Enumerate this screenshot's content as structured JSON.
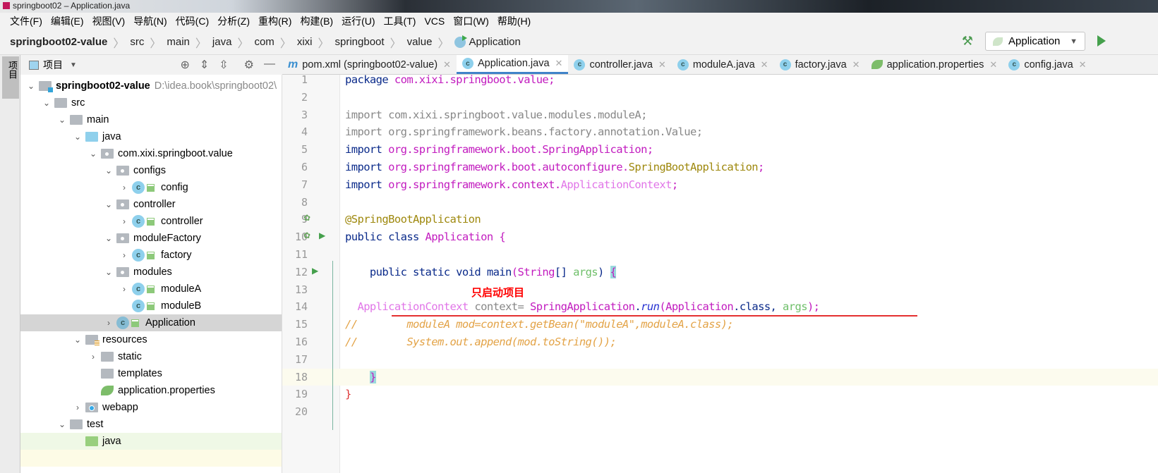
{
  "window": {
    "title": "springboot02 – Application.java"
  },
  "menu": [
    "文件(F)",
    "编辑(E)",
    "视图(V)",
    "导航(N)",
    "代码(C)",
    "分析(Z)",
    "重构(R)",
    "构建(B)",
    "运行(U)",
    "工具(T)",
    "VCS",
    "窗口(W)",
    "帮助(H)"
  ],
  "breadcrumb": [
    "springboot02-value",
    "src",
    "main",
    "java",
    "com",
    "xixi",
    "springboot",
    "value",
    "Application"
  ],
  "run_config": {
    "label": "Application"
  },
  "sidebar_tab": "项目",
  "project_panel": {
    "title": "项目"
  },
  "tree": [
    {
      "label": "springboot02-value",
      "path": "D:\\idea.book\\springboot02\\",
      "level": 0,
      "chev": "v",
      "icon": "module-folder",
      "bold": true
    },
    {
      "label": "src",
      "level": 1,
      "chev": "v",
      "icon": "folder"
    },
    {
      "label": "main",
      "level": 2,
      "chev": "v",
      "icon": "folder"
    },
    {
      "label": "java",
      "level": 3,
      "chev": "v",
      "icon": "source-folder"
    },
    {
      "label": "com.xixi.springboot.value",
      "level": 4,
      "chev": "v",
      "icon": "package"
    },
    {
      "label": "configs",
      "level": 5,
      "chev": "v",
      "icon": "package"
    },
    {
      "label": "config",
      "level": 6,
      "chev": ">",
      "icon": "class"
    },
    {
      "label": "controller",
      "level": 5,
      "chev": "v",
      "icon": "package"
    },
    {
      "label": "controller",
      "level": 6,
      "chev": ">",
      "icon": "class"
    },
    {
      "label": "moduleFactory",
      "level": 5,
      "chev": "v",
      "icon": "package"
    },
    {
      "label": "factory",
      "level": 6,
      "chev": ">",
      "icon": "class"
    },
    {
      "label": "modules",
      "level": 5,
      "chev": "v",
      "icon": "package"
    },
    {
      "label": "moduleA",
      "level": 6,
      "chev": ">",
      "icon": "class"
    },
    {
      "label": "moduleB",
      "level": 6,
      "chev": "",
      "icon": "class"
    },
    {
      "label": "Application",
      "level": 5,
      "chev": ">",
      "icon": "spring-class",
      "selected": true
    },
    {
      "label": "resources",
      "level": 3,
      "chev": "v",
      "icon": "resources-folder"
    },
    {
      "label": "static",
      "level": 4,
      "chev": ">",
      "icon": "folder"
    },
    {
      "label": "templates",
      "level": 4,
      "chev": "",
      "icon": "folder"
    },
    {
      "label": "application.properties",
      "level": 4,
      "chev": "",
      "icon": "spring"
    },
    {
      "label": "webapp",
      "level": 3,
      "chev": ">",
      "icon": "web-folder"
    },
    {
      "label": "test",
      "level": 2,
      "chev": "v",
      "icon": "folder"
    },
    {
      "label": "java",
      "level": 3,
      "chev": "",
      "icon": "test-folder",
      "green": true
    }
  ],
  "tabs": [
    {
      "label": "pom.xml (springboot02-value)",
      "icon": "maven"
    },
    {
      "label": "Application.java",
      "icon": "spring-class",
      "active": true
    },
    {
      "label": "controller.java",
      "icon": "class"
    },
    {
      "label": "moduleA.java",
      "icon": "class"
    },
    {
      "label": "factory.java",
      "icon": "class"
    },
    {
      "label": "application.properties",
      "icon": "spring"
    },
    {
      "label": "config.java",
      "icon": "class"
    }
  ],
  "code": [
    [
      [
        "package ",
        "k"
      ],
      [
        "com.xixi.springboot.value",
        "pk"
      ],
      [
        ";",
        "pk"
      ]
    ],
    [],
    [
      [
        "import com.xixi.springboot.value.modules.moduleA;",
        "gr"
      ]
    ],
    [
      [
        "import org.springframework.beans.factory.annotation.Value;",
        "gr"
      ]
    ],
    [
      [
        "import ",
        "k"
      ],
      [
        "org.springframework.boot.SpringApplication",
        "pk"
      ],
      [
        ";",
        "pk"
      ]
    ],
    [
      [
        "import ",
        "k"
      ],
      [
        "org.springframework.boot.autoconfigure.",
        "pk"
      ],
      [
        "SpringBootApplication",
        "an"
      ],
      [
        ";",
        "pk"
      ]
    ],
    [
      [
        "import ",
        "k"
      ],
      [
        "org.springframework.context.",
        "pk"
      ],
      [
        "ApplicationContext",
        "lp"
      ],
      [
        ";",
        "pk"
      ]
    ],
    [],
    [
      [
        "@SpringBootApplication",
        "an"
      ]
    ],
    [
      [
        "public class ",
        "k"
      ],
      [
        "Application ",
        "pk"
      ],
      [
        "{",
        "pk"
      ]
    ],
    [],
    [
      [
        "    public static void main",
        "k"
      ],
      [
        "(",
        "pk"
      ],
      [
        "String",
        "pk"
      ],
      [
        "[] ",
        "k"
      ],
      [
        "args",
        "ar"
      ],
      [
        ") ",
        "k"
      ],
      [
        "{",
        "br"
      ]
    ],
    [],
    [
      [
        "  ",
        "df"
      ],
      [
        "ApplicationContext ",
        "lp"
      ],
      [
        "context= ",
        "gr"
      ],
      [
        "SpringApplication",
        "pk"
      ],
      [
        ".",
        "k"
      ],
      [
        "run",
        "it"
      ],
      [
        "(",
        "pk"
      ],
      [
        "Application",
        "pk"
      ],
      [
        ".class, ",
        "k"
      ],
      [
        "args",
        "ar"
      ],
      [
        ");",
        "pk"
      ]
    ],
    [
      [
        "//",
        "cm"
      ],
      [
        "        moduleA mod=context.getBean(\"moduleA\",moduleA.class);",
        "cm"
      ]
    ],
    [
      [
        "//",
        "cm"
      ],
      [
        "        System.out.append(mod.toString());",
        "cm"
      ]
    ],
    [],
    [
      [
        "    ",
        "df"
      ],
      [
        "}",
        "br"
      ]
    ],
    [
      [
        "}",
        "rb"
      ]
    ],
    []
  ],
  "annotation": {
    "note": "只启动项目",
    "color": "#ff0000"
  },
  "colors": {
    "accent": "#4083c9",
    "run": "#45a04c",
    "selection": "#d5d5d5"
  }
}
